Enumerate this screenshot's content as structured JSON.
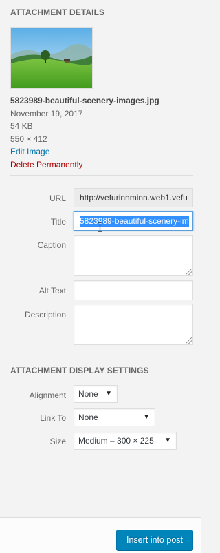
{
  "details": {
    "heading": "ATTACHMENT DETAILS",
    "filename": "5823989-beautiful-scenery-images.jpg",
    "date": "November 19, 2017",
    "size": "54 KB",
    "dimensions": "550 × 412",
    "edit_link": "Edit Image",
    "delete_link": "Delete Permanently"
  },
  "fields": {
    "url": {
      "label": "URL",
      "value": "http://vefurinnminn.web1.vefu"
    },
    "title": {
      "label": "Title",
      "value": "5823989-beautiful-scenery-im"
    },
    "caption": {
      "label": "Caption",
      "value": ""
    },
    "alt": {
      "label": "Alt Text",
      "value": ""
    },
    "description": {
      "label": "Description",
      "value": ""
    }
  },
  "display": {
    "heading": "ATTACHMENT DISPLAY SETTINGS",
    "alignment": {
      "label": "Alignment",
      "value": "None"
    },
    "link_to": {
      "label": "Link To",
      "value": "None"
    },
    "size": {
      "label": "Size",
      "value": "Medium – 300 × 225"
    }
  },
  "footer": {
    "insert_button": "Insert into post"
  },
  "colors": {
    "link": "#0073aa",
    "delete": "#aa0000",
    "primary_button": "#0085ba",
    "selection": "#3390ff"
  }
}
